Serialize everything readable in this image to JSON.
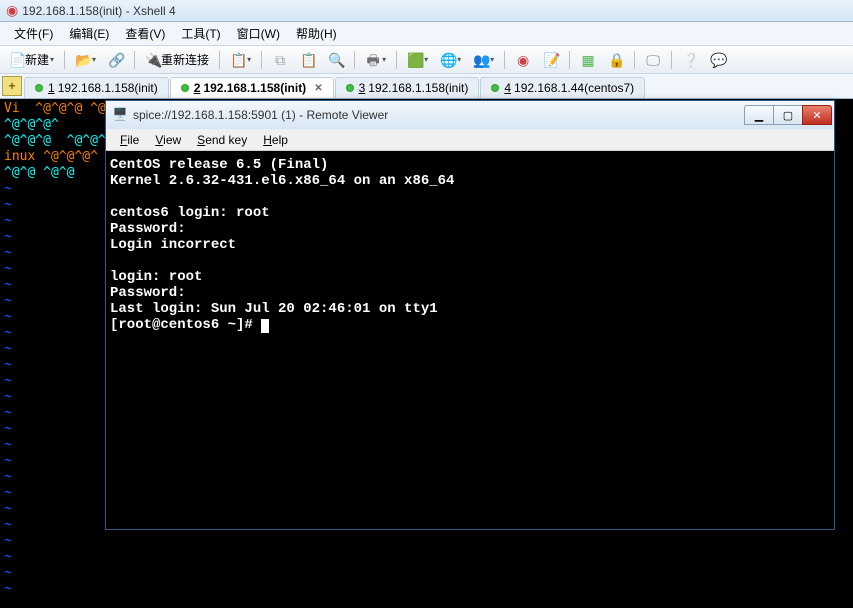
{
  "xshell": {
    "title": "192.168.1.158(init) - Xshell 4",
    "menus": {
      "file": "文件(F)",
      "edit": "编辑(E)",
      "view": "查看(V)",
      "tools": "工具(T)",
      "window": "窗口(W)",
      "help": "帮助(H)"
    },
    "toolbar": {
      "new_label": "新建",
      "reconnect_label": "重新连接"
    },
    "tabs": [
      {
        "num": "1",
        "label": "192.168.1.158(init)",
        "active": false,
        "close": false
      },
      {
        "num": "2",
        "label": "192.168.1.158(init)",
        "active": true,
        "close": true
      },
      {
        "num": "3",
        "label": "192.168.1.158(init)",
        "active": false,
        "close": false
      },
      {
        "num": "4",
        "label": "192.168.1.44(centos7)",
        "active": false,
        "close": false
      }
    ],
    "term": {
      "line1": "Vi  ^@^@^@ ^@^@ ^@^@ ^@",
      "line2": "^@^@^@^",
      "line3": "^@^@^@  ^@^@^ @",
      "line4": "inux ^@^@^@^ ^@",
      "line5": "^@^@ ^@^@"
    }
  },
  "rv": {
    "title": "spice://192.168.1.158:5901 (1) - Remote Viewer",
    "menus": {
      "file": "File",
      "view": "View",
      "sendkey": "Send key",
      "help": "Help"
    },
    "content": "CentOS release 6.5 (Final)\nKernel 2.6.32-431.el6.x86_64 on an x86_64\n\ncentos6 login: root\nPassword:\nLogin incorrect\n\nlogin: root\nPassword:\nLast login: Sun Jul 20 02:46:01 on tty1\n[root@centos6 ~]# "
  }
}
